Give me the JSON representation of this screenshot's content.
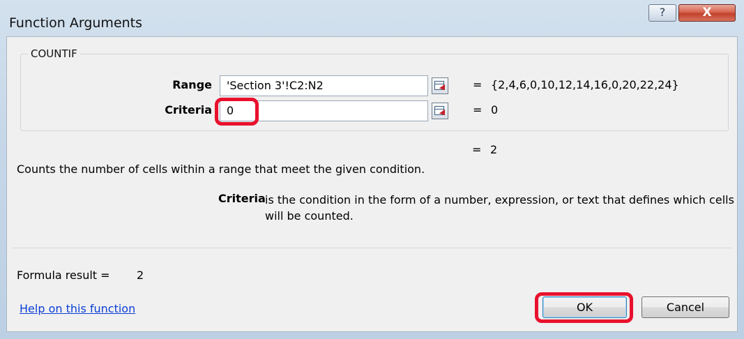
{
  "dialog": {
    "title": "Function Arguments",
    "help_glyph": "?",
    "close_glyph": "X"
  },
  "function": {
    "name": "COUNTIF",
    "args": [
      {
        "label": "Range",
        "value": "'Section 3'!C2:N2",
        "eq": "=",
        "evaluated": "{2,4,6,0,10,12,14,16,0,20,22,24}"
      },
      {
        "label": "Criteria",
        "value": "0",
        "eq": "=",
        "evaluated": "0"
      }
    ],
    "result_eq": "=",
    "result_value": "2",
    "description": "Counts the number of cells within a range that meet the given condition.",
    "arg_help_name": "Criteria",
    "arg_help_text": "is the condition in the form of a number, expression, or text that defines which cells will be counted."
  },
  "footer": {
    "formula_result_label": "Formula result =",
    "formula_result_value": "2",
    "help_link": "Help on this function",
    "ok_label": "OK",
    "cancel_label": "Cancel"
  },
  "colors": {
    "highlight": "#e8112d",
    "link": "#0b3fd6"
  },
  "icons": [
    "help-icon",
    "close-icon",
    "collapse-dialog-icon"
  ]
}
